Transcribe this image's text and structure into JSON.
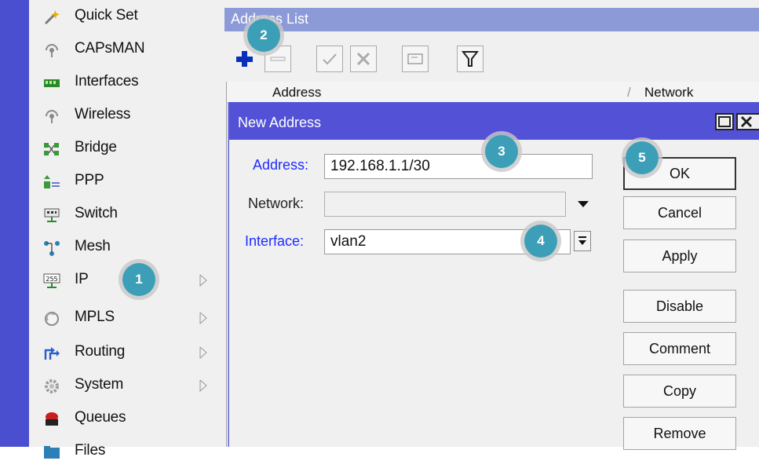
{
  "sidebar": {
    "items": [
      {
        "label": "Quick Set",
        "icon": "wand-icon",
        "has_submenu": false
      },
      {
        "label": "CAPsMAN",
        "icon": "antenna-icon",
        "has_submenu": false
      },
      {
        "label": "Interfaces",
        "icon": "network-card-icon",
        "has_submenu": false
      },
      {
        "label": "Wireless",
        "icon": "wireless-icon",
        "has_submenu": false
      },
      {
        "label": "Bridge",
        "icon": "bridge-icon",
        "has_submenu": false
      },
      {
        "label": "PPP",
        "icon": "ppp-icon",
        "has_submenu": false
      },
      {
        "label": "Switch",
        "icon": "switch-icon",
        "has_submenu": false
      },
      {
        "label": "Mesh",
        "icon": "mesh-icon",
        "has_submenu": false
      },
      {
        "label": "IP",
        "icon": "ip-icon",
        "has_submenu": true
      },
      {
        "label": "MPLS",
        "icon": "mpls-icon",
        "has_submenu": true
      },
      {
        "label": "Routing",
        "icon": "routing-icon",
        "has_submenu": true
      },
      {
        "label": "System",
        "icon": "gear-icon",
        "has_submenu": true
      },
      {
        "label": "Queues",
        "icon": "queues-icon",
        "has_submenu": false
      },
      {
        "label": "Files",
        "icon": "folder-icon",
        "has_submenu": false
      }
    ]
  },
  "address_list": {
    "title": "Address List",
    "toolbar": [
      "add-icon",
      "remove-icon",
      "enable-icon",
      "disable-icon",
      "comment-icon",
      "filter-icon"
    ],
    "columns": [
      "Address",
      "Network"
    ]
  },
  "dialog": {
    "title": "New Address",
    "fields": {
      "address": {
        "label": "Address:",
        "value": "192.168.1.1/30"
      },
      "network": {
        "label": "Network:",
        "value": ""
      },
      "interface": {
        "label": "Interface:",
        "value": "vlan2"
      }
    },
    "buttons": [
      "OK",
      "Cancel",
      "Apply",
      "Disable",
      "Comment",
      "Copy",
      "Remove"
    ]
  },
  "badges": [
    "1",
    "2",
    "3",
    "4",
    "5"
  ],
  "colors": {
    "accent_stripe": "#4a4fd0",
    "dialog_title": "#5352d6",
    "list_title": "#8c9bd8",
    "field_label_blue": "#1f2cff",
    "badge": "#3d9fb7"
  }
}
